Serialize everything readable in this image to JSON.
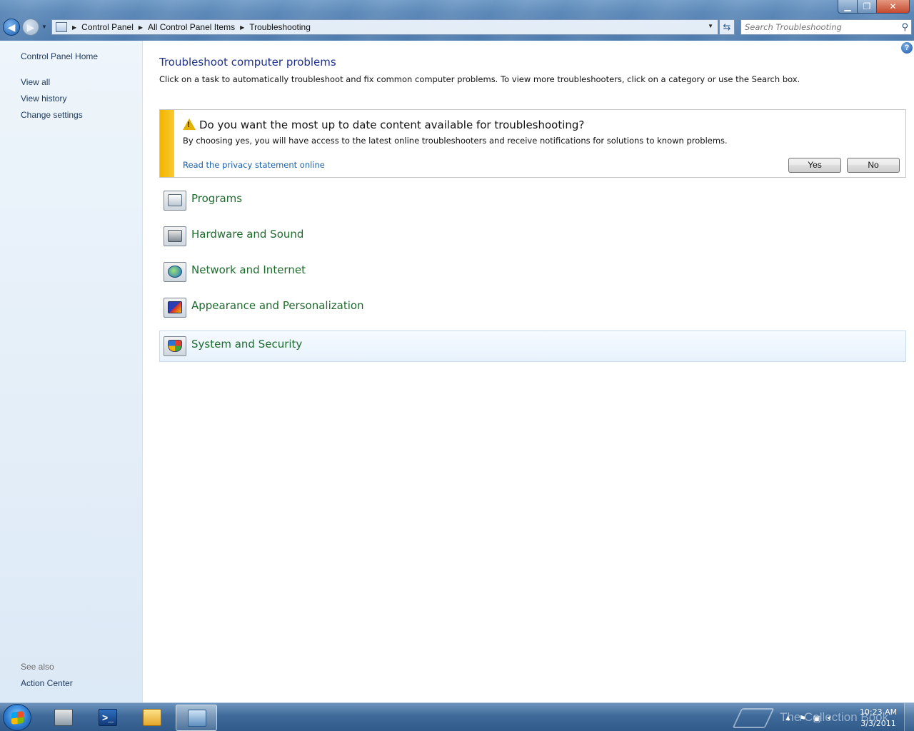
{
  "window": {
    "title": "Troubleshooting",
    "controls": {
      "minimize": "▁",
      "maximize": "❐",
      "close": "✕"
    }
  },
  "address_bar": {
    "breadcrumbs": [
      "Control Panel",
      "All Control Panel Items",
      "Troubleshooting"
    ],
    "search_placeholder": "Search Troubleshooting"
  },
  "left_pane": {
    "home": "Control Panel Home",
    "links": [
      "View all",
      "View history",
      "Change settings"
    ],
    "see_also_label": "See also",
    "see_also_links": [
      "Action Center"
    ]
  },
  "main": {
    "title": "Troubleshoot computer problems",
    "description": "Click on a task to automatically troubleshoot and fix common computer problems. To view more troubleshooters, click on a category or use the Search box.",
    "infobar": {
      "heading": "Do you want the most up to date content available for troubleshooting?",
      "text": "By choosing yes, you will have access to the latest online troubleshooters and receive notifications for solutions to known problems.",
      "link": "Read the privacy statement online",
      "yes": "Yes",
      "no": "No"
    },
    "categories": [
      {
        "label": "Programs",
        "icon": "programs-icon"
      },
      {
        "label": "Hardware and Sound",
        "icon": "hardware-sound-icon"
      },
      {
        "label": "Network and Internet",
        "icon": "network-internet-icon"
      },
      {
        "label": "Appearance and Personalization",
        "icon": "appearance-icon"
      },
      {
        "label": "System and Security",
        "icon": "system-security-icon"
      }
    ]
  },
  "taskbar": {
    "items": [
      "start-orb",
      "server-manager-icon",
      "powershell-icon",
      "windows-explorer-icon",
      "control-panel-icon"
    ],
    "watermark": "The Collection Book",
    "clock_time": "10:23 AM",
    "clock_date": "3/3/2011"
  },
  "colors": {
    "link_blue": "#1e395b",
    "category_green": "#1e6b2e",
    "title_blue": "#1e3287",
    "infobar_stripe": "#f4b400"
  }
}
